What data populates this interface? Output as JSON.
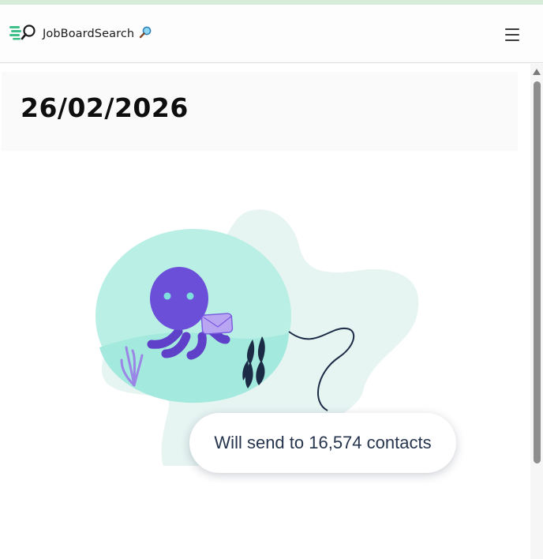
{
  "header": {
    "brand_name": "JobBoardSearch",
    "logo_icon": "speed-lines-magnifier-icon",
    "brand_emoji": "magnifying-glass-icon",
    "menu_icon": "hamburger-menu-icon"
  },
  "main": {
    "date": "26/02/2026",
    "illustration": "octopus-holding-envelope",
    "send_summary": "Will send to 16,574 contacts"
  },
  "colors": {
    "blob_light": "#e6f4f2",
    "blob_mint": "#b9efe4",
    "octopus": "#6c4fd8",
    "navy": "#1b2b45",
    "text_navy": "#26354d"
  }
}
